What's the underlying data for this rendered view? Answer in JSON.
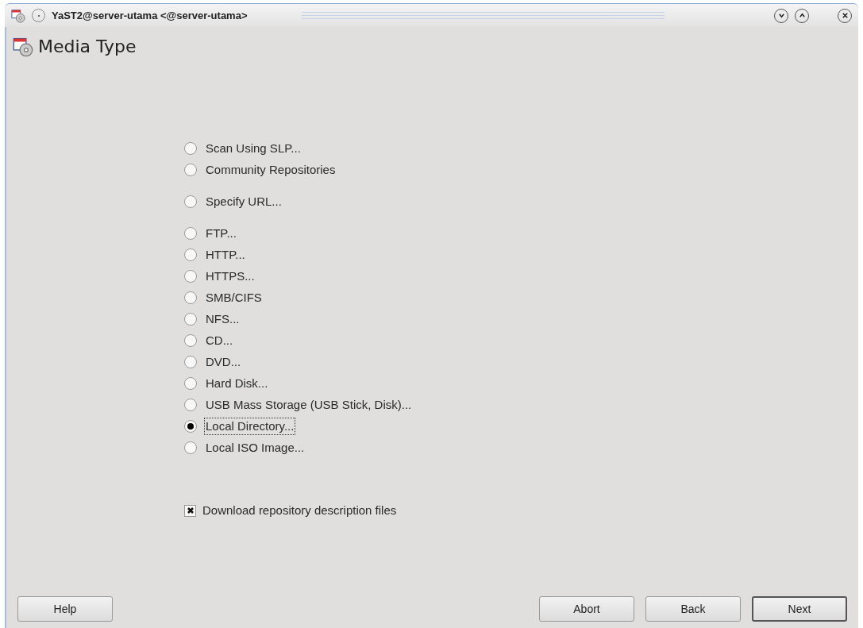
{
  "window": {
    "title": "YaST2@server-utama <@server-utama>"
  },
  "heading": "Media Type",
  "option_groups": [
    [
      {
        "label": "Scan Using SLP...",
        "selected": false,
        "focused": false
      },
      {
        "label": "Community Repositories",
        "selected": false,
        "focused": false
      }
    ],
    [
      {
        "label": "Specify URL...",
        "selected": false,
        "focused": false
      }
    ],
    [
      {
        "label": "FTP...",
        "selected": false,
        "focused": false
      },
      {
        "label": "HTTP...",
        "selected": false,
        "focused": false
      },
      {
        "label": "HTTPS...",
        "selected": false,
        "focused": false
      },
      {
        "label": "SMB/CIFS",
        "selected": false,
        "focused": false
      },
      {
        "label": "NFS...",
        "selected": false,
        "focused": false
      },
      {
        "label": "CD...",
        "selected": false,
        "focused": false
      },
      {
        "label": "DVD...",
        "selected": false,
        "focused": false
      },
      {
        "label": "Hard Disk...",
        "selected": false,
        "focused": false
      },
      {
        "label": "USB Mass Storage (USB Stick, Disk)...",
        "selected": false,
        "focused": false
      },
      {
        "label": "Local Directory...",
        "selected": true,
        "focused": true
      },
      {
        "label": "Local ISO Image...",
        "selected": false,
        "focused": false
      }
    ]
  ],
  "download_checkbox": {
    "label": "Download repository description files",
    "checked": true
  },
  "buttons_left": [
    "Help"
  ],
  "buttons_right": [
    "Abort",
    "Back",
    "Next"
  ]
}
